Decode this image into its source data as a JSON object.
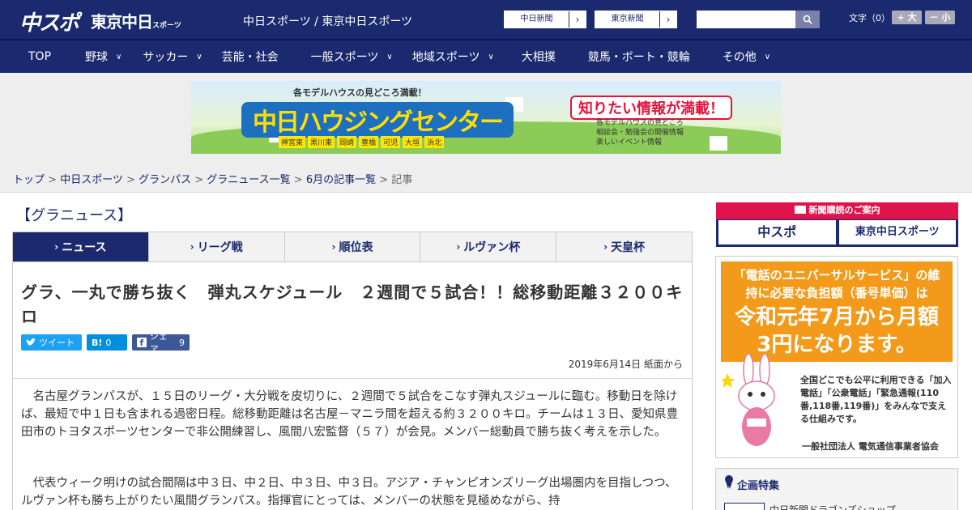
{
  "header": {
    "logo_chuspo": "中スポ",
    "logo_tokyo": "東京中日",
    "logo_tokyo_suffix": "スポーツ",
    "site_name": "中日スポーツ / 東京中日スポーツ",
    "paper_links": [
      {
        "label": "中日新聞",
        "arrow": "›"
      },
      {
        "label": "東京新聞",
        "arrow": "›"
      }
    ],
    "search_placeholder": "",
    "font_size_label": "文字（0）",
    "zoom_in": "+ 大",
    "zoom_out": "－ 小"
  },
  "nav": {
    "items": [
      {
        "label": "TOP",
        "has_menu": false
      },
      {
        "label": "野球",
        "has_menu": true
      },
      {
        "label": "サッカー",
        "has_menu": true
      },
      {
        "label": "芸能・社会",
        "has_menu": false
      },
      {
        "label": "一般スポーツ",
        "has_menu": true
      },
      {
        "label": "地域スポーツ",
        "has_menu": true
      },
      {
        "label": "大相撲",
        "has_menu": false
      },
      {
        "label": "競馬・ボート・競輪",
        "has_menu": false
      },
      {
        "label": "その他",
        "has_menu": true
      }
    ]
  },
  "banner": {
    "top_text": "各モデルハウスの見どころ満載！",
    "title": "中日ハウジングセンター",
    "right_text": "知りたい情報が満載！",
    "list": [
      "各モデルハウスの見どころ",
      "相談会・勉強会の開催情報",
      "楽しいイベント情報"
    ],
    "towns": [
      "神宮東",
      "黒川東",
      "岡崎",
      "豊橋",
      "可児",
      "大垣",
      "浜北"
    ]
  },
  "breadcrumb": {
    "items": [
      "トップ",
      "中日スポーツ",
      "グランパス",
      "グラニュース一覧",
      "6月の記事一覧"
    ],
    "current": "記事",
    "sep": " > "
  },
  "section_title": "【グラニュース】",
  "tabs": [
    {
      "label": "ニュース",
      "active": true
    },
    {
      "label": "リーグ戦",
      "active": false
    },
    {
      "label": "順位表",
      "active": false
    },
    {
      "label": "ルヴァン杯",
      "active": false
    },
    {
      "label": "天皇杯",
      "active": false
    }
  ],
  "article": {
    "headline": "グラ、一丸で勝ち抜く　弾丸スケジュール　２週間で５試合！！総移動距離３２００キロ",
    "share": {
      "tweet": "ツイート",
      "hatena_count": "0",
      "fb_label": "シェア",
      "fb_count": "9"
    },
    "date": "2019年6月14日 紙面から",
    "paragraphs": [
      "名古屋グランパスが、１５日のリーグ・大分戦を皮切りに、２週間で５試合をこなす弾丸スジュールに臨む。移動日を除けば、最短で中１日も含まれる過密日程。総移動距離は名古屋－マニラ間を超える約３２００キロ。チームは１３日、愛知県豊田市のトヨタスポーツセンターで非公開練習し、風間八宏監督（５７）が会見。メンバー総動員で勝ち抜く考えを示した。",
      "代表ウィーク明けの試合間隔は中３日、中２日、中３日、中３日。アジア・チャンピオンズリーグ出場圏内を目指しつつ、ルヴァン杯も勝ち上がりたい風間グランパス。指揮官にとっては、メンバーの状態を見極めながら、持"
    ]
  },
  "sidebar": {
    "subscribe_title": "新聞購読のご案内",
    "subscribe_logos": [
      "中スポ",
      "東京中日スポーツ"
    ],
    "universal_ad": {
      "lead": "「電話のユニバーサルサービス」の維持に必要な負担額（番号単価）は",
      "big": "令和元年7月から月額3円になります。",
      "desc": "全国どこでも公平に利用できる「加入電話」「公衆電話」「緊急通報(110番,118番,119番)」をみんなで支える仕組みです。",
      "org": "一般社団法人 電気通信事業者協会"
    },
    "feature_title": "企画特集",
    "feature_item": "中日新聞ドラゴンズショップ"
  },
  "colors": {
    "brand_navy": "#1b2a6e",
    "accent_red": "#e0144c",
    "ad_orange": "#f39a1a",
    "twitter": "#1da1f2",
    "hatena": "#008fde",
    "facebook": "#3b5998"
  }
}
